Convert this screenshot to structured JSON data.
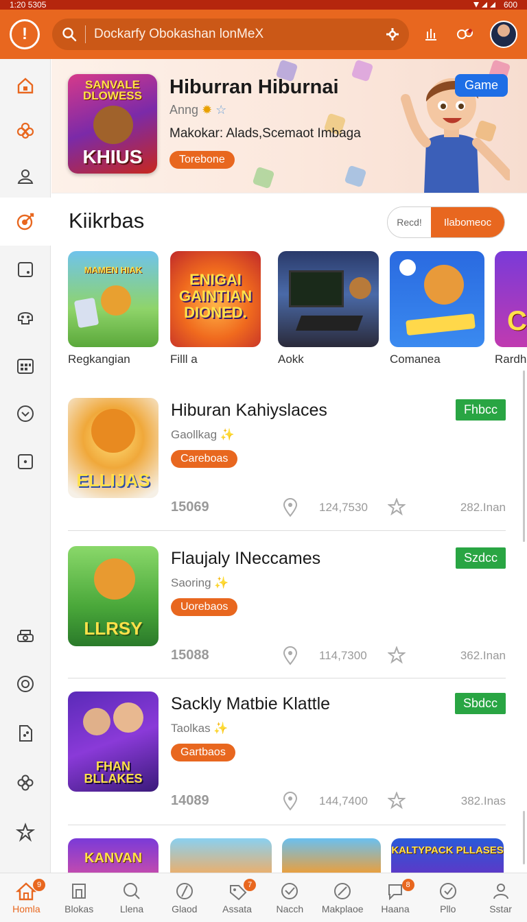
{
  "statusbar": {
    "time": "1:20 5305",
    "battery": "600"
  },
  "search": {
    "text": "Dockarfy Obokashan lonMeX"
  },
  "hero": {
    "art_top": "SANVALE DLOWESS",
    "art_bottom": "KHIUS",
    "title": "Hiburran Hiburnai",
    "subtitle": "Anng",
    "description": "Makokar: Alads,Scemaot Imbaga",
    "pill": "Torebone",
    "badge": "Game"
  },
  "section": {
    "title": "Kiikrbas",
    "seg_left": "Recd!",
    "seg_right": "Ilabomeoc"
  },
  "carousel": [
    {
      "label": "Regkangian",
      "art": "MAMEN HIAK"
    },
    {
      "label": "Filll a",
      "art": "ENIGAI GAINTIAN DIONED."
    },
    {
      "label": "Aokk",
      "art": ""
    },
    {
      "label": "Comanea",
      "art": ""
    },
    {
      "label": "Rardh",
      "art": "C"
    }
  ],
  "list": [
    {
      "title": "Hiburan Kahiyslaces",
      "sub": "Gaollkag",
      "pill": "Careboas",
      "status": "Fhbcc",
      "n1": "15069",
      "n2": "124,7530",
      "n3": "282.Inan",
      "art": "ELLIJAS"
    },
    {
      "title": "Flaujaly INeccames",
      "sub": "Saoring",
      "pill": "Uorebaos",
      "status": "Szdcc",
      "n1": "15088",
      "n2": "114,7300",
      "n3": "362.Inan",
      "art": "LLRSY"
    },
    {
      "title": "Sackly Matbie Klattle",
      "sub": "Taolkas",
      "pill": "Gartbaos",
      "status": "Sbdcc",
      "n1": "14089",
      "n2": "144,7400",
      "n3": "382.Inas",
      "art": "FHAN BLLAKES"
    }
  ],
  "peek": [
    "KANVAN",
    "",
    "",
    "KALTYPACK PLLASES"
  ],
  "bottom_nav": [
    {
      "label": "Homla",
      "badge": "9",
      "icon": "home-icon"
    },
    {
      "label": "Blokas",
      "badge": "",
      "icon": "blocks-icon"
    },
    {
      "label": "Llena",
      "badge": "",
      "icon": "search-icon"
    },
    {
      "label": "Glaod",
      "badge": "",
      "icon": "slash-circle-icon"
    },
    {
      "label": "Assata",
      "badge": "7",
      "icon": "tag-icon"
    },
    {
      "label": "Nacch",
      "badge": "",
      "icon": "check-circle-icon"
    },
    {
      "label": "Makplaoe",
      "badge": "",
      "icon": "leaf-icon"
    },
    {
      "label": "Haana",
      "badge": "8",
      "icon": "chat-icon"
    },
    {
      "label": "Pllo",
      "badge": "",
      "icon": "check-icon"
    },
    {
      "label": "Sstar",
      "badge": "",
      "icon": "person-icon"
    }
  ],
  "colors": {
    "accent": "#e8671f",
    "status_green": "#29a543",
    "badge_blue": "#1e6ee6"
  }
}
